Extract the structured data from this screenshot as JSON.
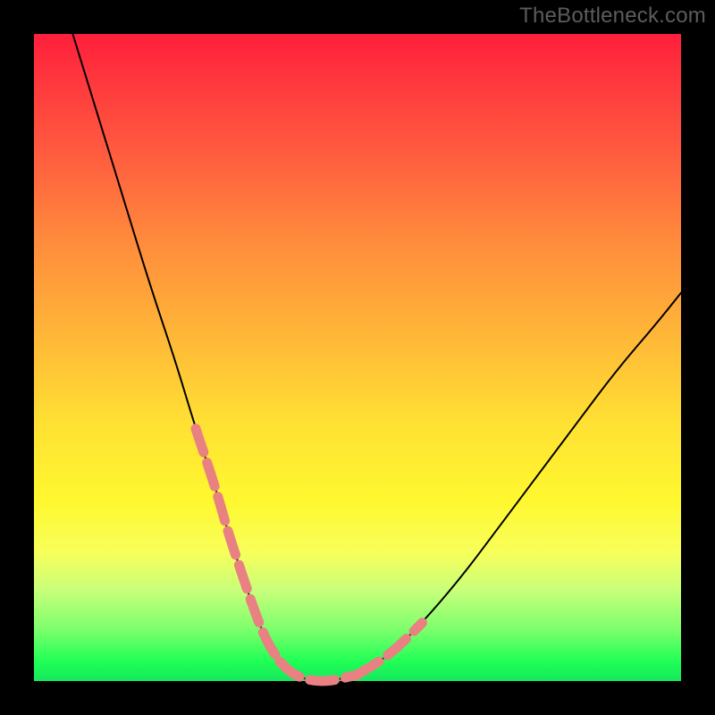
{
  "watermark": "TheBottleneck.com",
  "chart_data": {
    "type": "line",
    "title": "",
    "xlabel": "",
    "ylabel": "",
    "xlim": [
      0,
      100
    ],
    "ylim": [
      0,
      100
    ],
    "grid": false,
    "legend": false,
    "series": [
      {
        "name": "bottleneck-curve",
        "x": [
          6,
          10,
          14,
          18,
          22,
          25,
          28,
          30,
          32,
          34,
          36,
          38,
          40,
          43,
          46,
          50,
          55,
          60,
          66,
          72,
          78,
          84,
          90,
          96,
          100
        ],
        "y": [
          100,
          87,
          74,
          61,
          49,
          39,
          30,
          23,
          17,
          11,
          6,
          3,
          1,
          0,
          0,
          1,
          4,
          9,
          16,
          24,
          32,
          40,
          48,
          55,
          60
        ]
      }
    ],
    "annotations": [
      {
        "name": "highlight-left-descent",
        "type": "dashed-overlay",
        "x_range": [
          25,
          38
        ],
        "note": "salmon dashed segment on left slope"
      },
      {
        "name": "highlight-valley",
        "type": "dashed-overlay",
        "x_range": [
          38,
          50
        ],
        "note": "salmon dashed segment across valley floor"
      },
      {
        "name": "highlight-right-ascent",
        "type": "dashed-overlay",
        "x_range": [
          50,
          64
        ],
        "note": "salmon dashed segment on right slope"
      }
    ],
    "colors": {
      "curve": "#000000",
      "highlight": "#e98182",
      "gradient_top": "#ff1f3b",
      "gradient_bottom": "#16e85e"
    }
  }
}
